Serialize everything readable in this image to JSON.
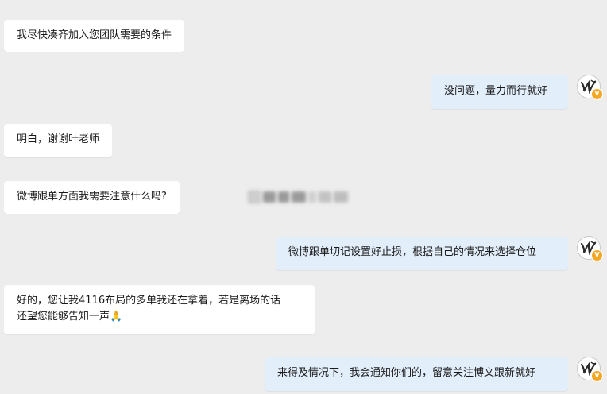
{
  "messages": [
    {
      "side": "left",
      "text": "我尽快凑齐加入您团队需要的条件"
    },
    {
      "side": "right",
      "text": "没问题，量力而行就好"
    },
    {
      "side": "left",
      "text": "明白，谢谢叶老师"
    },
    {
      "side": "left",
      "text": "微博跟单方面我需要注意什么吗?"
    },
    {
      "side": "right",
      "text": "微博跟单切记设置好止损，根据自己的情况来选择仓位"
    },
    {
      "side": "left",
      "line1": "好的，您让我4116布局的多单我还在拿着，若是离场的话",
      "line2": "还望您能够告知一声",
      "emoji": "🙏"
    },
    {
      "side": "right",
      "text": "来得及情况下，我会通知你们的，留意关注博文跟新就好"
    }
  ],
  "avatar_badge": "V",
  "colors": {
    "background": "#ededed",
    "left_bubble": "#ffffff",
    "right_bubble": "#e3eefb",
    "badge": "#f5a623"
  }
}
